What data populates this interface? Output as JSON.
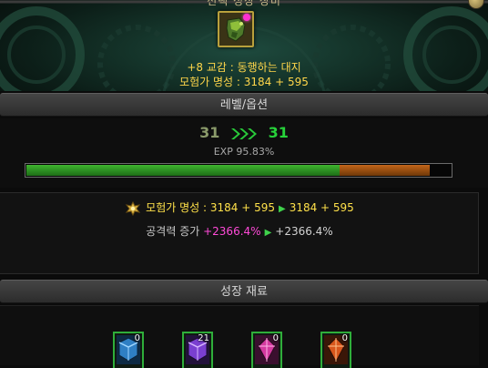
{
  "header": {
    "title": "선택 성장 장비"
  },
  "item": {
    "name": "+8 교감 : 동행하는 대지",
    "fame": "모험가 명성 : 3184 + 595",
    "icon": "green-gauntlet-icon"
  },
  "level_section": {
    "title": "레벨/옵션",
    "level_from": "31",
    "level_to": "31",
    "exp_text": "EXP 95.83%",
    "exp_progress": 0.7383,
    "exp_extra": 0.2128
  },
  "stats": {
    "fame_label": "모험가 명성",
    "fame_before": "3184 + 595",
    "fame_after": "3184 + 595",
    "attack_label": "공격력 증가",
    "attack_before": "+2366.4%",
    "attack_after": "+2366.4%"
  },
  "materials_section": {
    "title": "성장 재료",
    "items": [
      {
        "icon": "blue-cube-icon",
        "count": "0"
      },
      {
        "icon": "purple-cube-icon",
        "count": "21"
      },
      {
        "icon": "pink-crystal-icon",
        "count": "0"
      },
      {
        "icon": "orange-crystal-icon",
        "count": "0"
      }
    ]
  },
  "colors": {
    "level_to": "#27d23a",
    "exp_green": "#3fb52f",
    "exp_orange": "#c2661a",
    "gold_text": "#ffd64a",
    "pink_text": "#ff4ad8"
  }
}
